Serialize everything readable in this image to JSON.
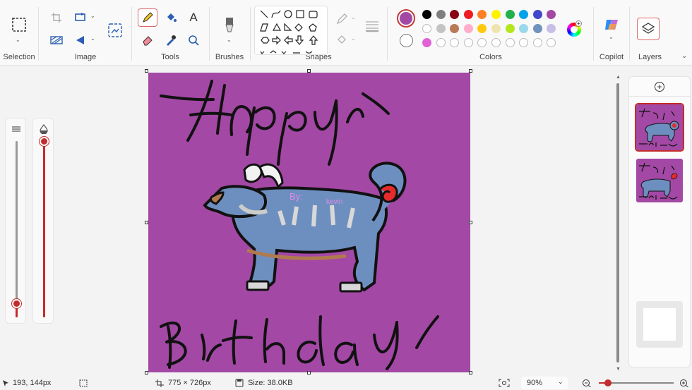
{
  "ribbon": {
    "groups": {
      "selection": "Selection",
      "image": "Image",
      "tools": "Tools",
      "brushes": "Brushes",
      "shapes": "Shapes",
      "colors": "Colors",
      "copilot": "Copilot",
      "layers": "Layers"
    },
    "text_tool_glyph": "A",
    "active_color": "#a348a5",
    "palette_row1": [
      "#000000",
      "#7f7f7f",
      "#880015",
      "#ed1c24",
      "#ff7f27",
      "#fff200",
      "#22b14c",
      "#00a2e8",
      "#3f48cc",
      "#a349a4"
    ],
    "palette_row2": [
      "#ffffff",
      "#c3c3c3",
      "#b97a57",
      "#ffaec9",
      "#ffc90e",
      "#efe4b0",
      "#b5e61d",
      "#99d9ea",
      "#7092be",
      "#c8bfe7"
    ],
    "palette_row3": [
      "#e062d6",
      "",
      "",
      "",
      "",
      "",
      "",
      "",
      "",
      ""
    ]
  },
  "canvas": {
    "background": "#a348a5",
    "text_top": "Happy",
    "text_bottom": "Birthday",
    "signature_by": "By:",
    "signature_name": "kevin"
  },
  "sliders": {
    "size_level": 0.08,
    "opacity_level": 1.0
  },
  "layers_panel": {
    "add_glyph": "+",
    "layer_count": 2
  },
  "status": {
    "cursor_position": "193, 144px",
    "canvas_size": "775 × 726px",
    "file_size": "Size: 38.0KB",
    "zoom": "90%"
  }
}
